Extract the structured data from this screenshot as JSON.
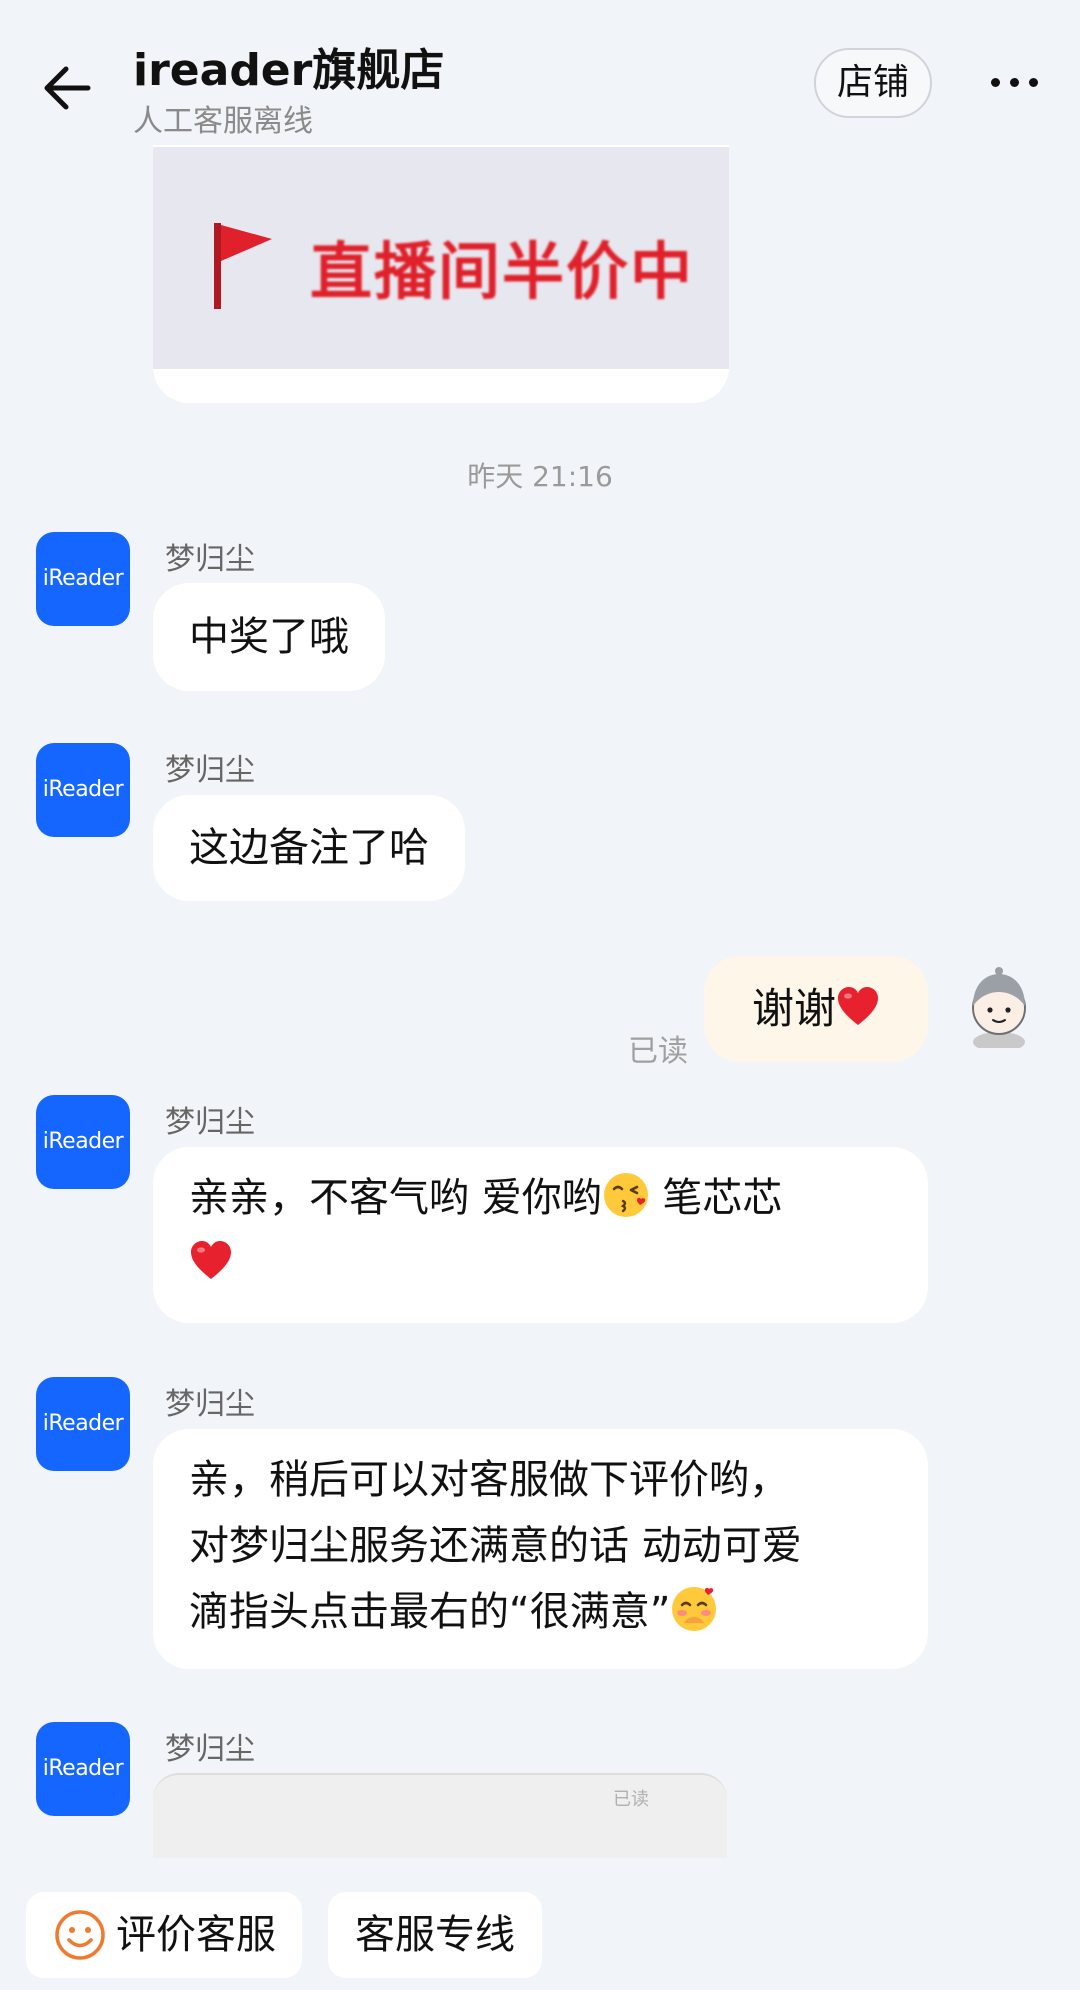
{
  "header": {
    "shop_name": "ireader旗舰店",
    "service_status": "人工客服离线",
    "store_button": "店铺"
  },
  "image_card": {
    "banner_text": "直播间半价中"
  },
  "chat": {
    "timestamp": "昨天 21:16",
    "agent_name": "梦归尘",
    "shop_avatar_text": "iReader",
    "messages": [
      {
        "from": "agent",
        "text": "中奖了哦"
      },
      {
        "from": "agent",
        "text": "这边备注了哈"
      },
      {
        "from": "me",
        "text": "谢谢",
        "status": "已读"
      },
      {
        "from": "agent",
        "text": "亲亲，不客气哟 爱你哟",
        "text_after_emoji": " 笔芯芯"
      },
      {
        "from": "agent",
        "lines": [
          "亲，稍后可以对客服做下评价哟，",
          "对梦归尘服务还满意的话 动动可爱",
          "滴指头点击最右的“很满意”"
        ]
      },
      {
        "from": "agent",
        "type": "image",
        "overlay_text": "已读"
      }
    ]
  },
  "bottom_bar": {
    "rate_service": "评价客服",
    "service_hotline": "客服专线"
  },
  "colors": {
    "background": "#f1f5f9",
    "shop_avatar": "#1565ff",
    "my_bubble": "#fdf6e9",
    "banner_red": "#e0202a"
  },
  "icons": [
    "back-arrow-icon",
    "more-dots-icon",
    "flag-icon",
    "heart-emoji-icon",
    "kiss-emoji-icon",
    "blush-emoji-icon",
    "smile-icon",
    "user-avatar-icon"
  ]
}
